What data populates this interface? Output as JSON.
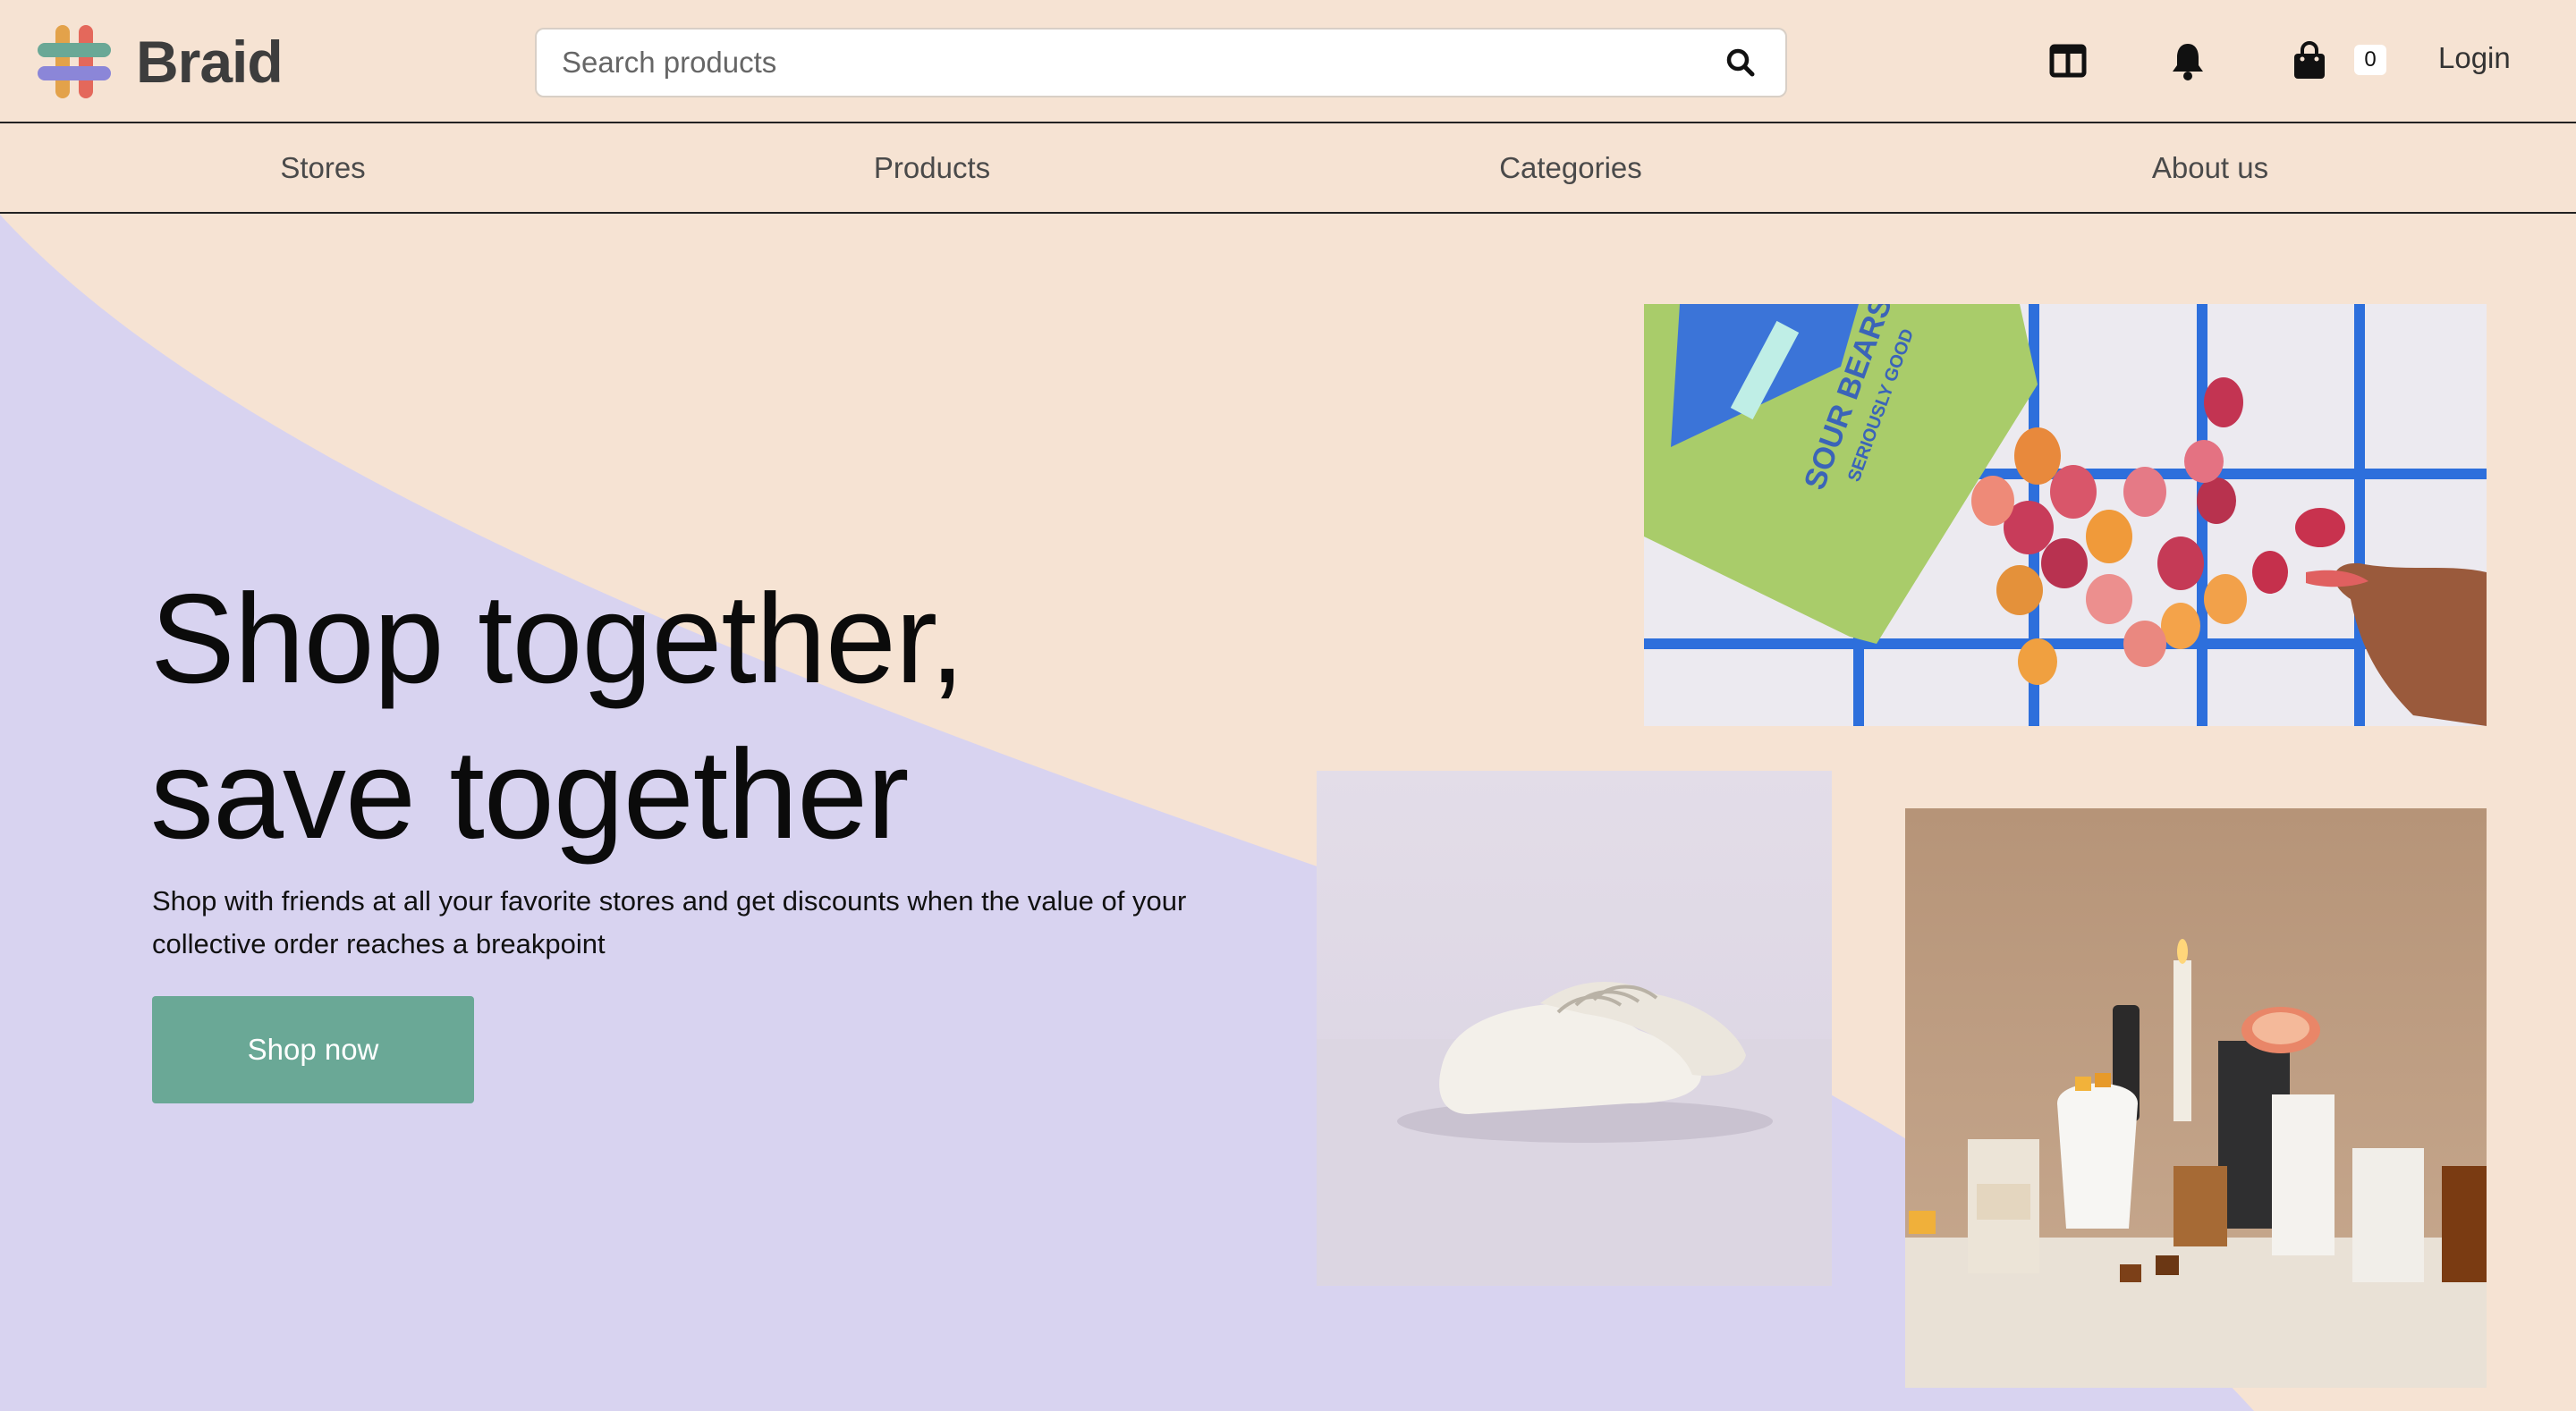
{
  "brand": {
    "name": "Braid",
    "logo_icon": "braid-logo-icon"
  },
  "search": {
    "placeholder": "Search products",
    "icon": "search-icon"
  },
  "header_icons": [
    {
      "name": "catalog-icon"
    },
    {
      "name": "bell-icon"
    },
    {
      "name": "shopping-bag-icon"
    }
  ],
  "cart": {
    "count": "0"
  },
  "login": {
    "label": "Login"
  },
  "nav": {
    "items": [
      {
        "label": "Stores"
      },
      {
        "label": "Products"
      },
      {
        "label": "Categories"
      },
      {
        "label": "About us"
      }
    ]
  },
  "hero": {
    "title_line1": "Shop together,",
    "title_line2": "save together",
    "subtitle": "Shop with friends at all your favorite stores and get discounts when the value of your collective order reaches a breakpoint",
    "cta_label": "Shop now"
  },
  "images": {
    "gummy_bag_text": "SOUR BEARS",
    "gummy_bag_tagline": "SERIOUSLY GOOD"
  },
  "colors": {
    "background": "#f6e3d3",
    "lavender": "#d8d3f0",
    "cta": "#6aa896",
    "grid_blue": "#2d6fdc",
    "bag_green": "#a9cc6a"
  }
}
